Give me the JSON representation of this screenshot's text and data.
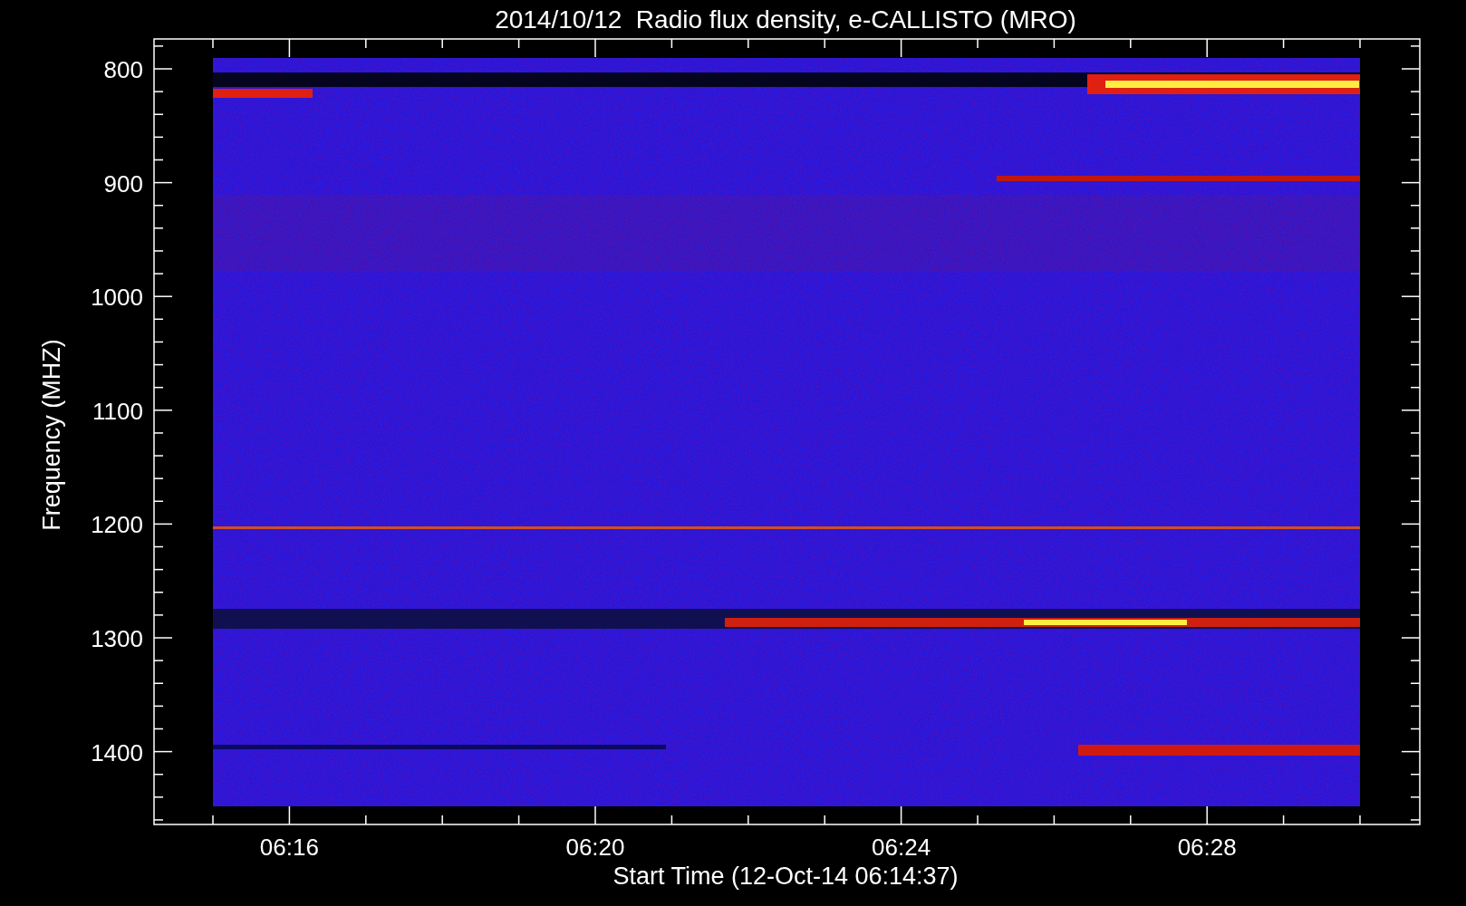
{
  "title": "2014/10/12  Radio flux density, e-CALLISTO (MRO)",
  "y_axis": {
    "label": "Frequency (MHZ)",
    "ticks": [
      "800",
      "900",
      "1000",
      "1100",
      "1200",
      "1300",
      "1400"
    ]
  },
  "x_axis": {
    "label": "Start Time (12-Oct-14 06:14:37)",
    "ticks": [
      "06:16",
      "06:20",
      "06:24",
      "06:28"
    ]
  }
}
